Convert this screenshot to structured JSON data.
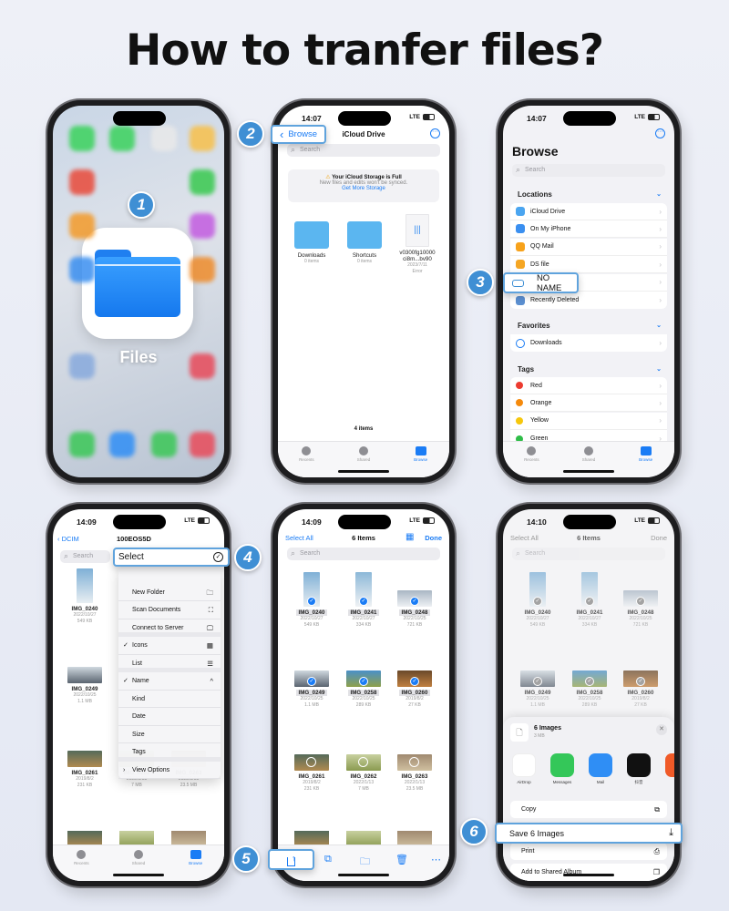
{
  "title": "How to tranfer files?",
  "colors": {
    "accent": "#1a7cf5",
    "badge": "#3f8fd4",
    "callout_border": "#5fa3dd"
  },
  "steps": [
    "1",
    "2",
    "3",
    "4",
    "5",
    "6"
  ],
  "phone1": {
    "app_label": "Files",
    "icon": "files-folder-icon"
  },
  "phone2": {
    "time": "14:07",
    "network": "LTE",
    "back_label": "Browse",
    "title": "iCloud Drive",
    "search_placeholder": "Search",
    "storage": {
      "title": "Your iCloud Storage is Full",
      "subtitle": "New files and edits won't be synced.",
      "link": "Get More Storage"
    },
    "items": [
      {
        "name": "Downloads",
        "meta": "0 items"
      },
      {
        "name": "Shortcuts",
        "meta": "0 items"
      },
      {
        "name": "v0300fg10000 ci8m...bv90",
        "meta": "2023/7/11",
        "meta2": "Error"
      }
    ],
    "count": "4 items",
    "tabs": [
      "Recents",
      "Shared",
      "Browse"
    ]
  },
  "phone3": {
    "time": "14:07",
    "network": "LTE",
    "title": "Browse",
    "search_placeholder": "Search",
    "locations_label": "Locations",
    "locations": [
      {
        "label": "iCloud Drive",
        "color": "#4aa5f0"
      },
      {
        "label": "On My iPhone",
        "color": "#3a8ff0"
      },
      {
        "label": "QQ Mail",
        "color": "#f7a21b"
      },
      {
        "label": "DS file",
        "color": "#f5a623"
      },
      {
        "label": "NO NAME",
        "color": "#8e8e93"
      },
      {
        "label": "Recently Deleted",
        "color": "#5b8fd0"
      }
    ],
    "favorites_label": "Favorites",
    "favorites": [
      {
        "label": "Downloads"
      }
    ],
    "tags_label": "Tags",
    "tags": [
      {
        "label": "Red",
        "color": "#ec3b30"
      },
      {
        "label": "Orange",
        "color": "#f58a0c"
      },
      {
        "label": "Yellow",
        "color": "#f6c70c"
      },
      {
        "label": "Green",
        "color": "#2fbd48"
      }
    ],
    "tabs": [
      "Recents",
      "Shared",
      "Browse"
    ]
  },
  "phone4": {
    "time": "14:09",
    "network": "LTE",
    "back_label": "DCIM",
    "title": "100EOS5D",
    "search_placeholder": "Search",
    "menu": [
      {
        "label": "Select",
        "icon": "checkmark-circle-icon",
        "glyph": "✓"
      },
      {
        "label": "New Folder",
        "icon": "new-folder-icon",
        "glyph": "🗀"
      },
      {
        "label": "Scan Documents",
        "icon": "scan-icon",
        "glyph": "⛶"
      },
      {
        "label": "Connect to Server",
        "icon": "monitor-icon",
        "glyph": "🖵"
      },
      {
        "label": "Icons",
        "checked": true,
        "icon": "grid-icon",
        "glyph": "▦"
      },
      {
        "label": "List",
        "icon": "list-icon",
        "glyph": "☰"
      },
      {
        "label": "Name",
        "checked": true,
        "icon": "chevron-up-icon",
        "glyph": "^"
      },
      {
        "label": "Kind"
      },
      {
        "label": "Date"
      },
      {
        "label": "Size"
      },
      {
        "label": "Tags"
      },
      {
        "label": "View Options",
        "prefix": ">"
      }
    ],
    "files": [
      {
        "name": "IMG_0240",
        "date": "2022/10/27",
        "size": "549 KB"
      },
      {
        "name": "IMG_0249",
        "date": "2022/10/25",
        "size": "1.1 MB"
      },
      {
        "name": "IMG_0261",
        "date": "2019/8/2",
        "size": "231 KB"
      },
      {
        "name": "IMG_0262",
        "date": "2022/1/13",
        "size": "7 MB"
      },
      {
        "name": "IMG_0263",
        "date": "2022/1/13",
        "size": "23.5 MB"
      }
    ],
    "tabs": [
      "Recents",
      "Shared",
      "Browse"
    ]
  },
  "phone5": {
    "time": "14:09",
    "network": "LTE",
    "select_all": "Select All",
    "title": "6 Items",
    "done": "Done",
    "search_placeholder": "Search",
    "files": [
      {
        "name": "IMG_0240",
        "date": "2022/10/27",
        "size": "549 KB",
        "selected": true
      },
      {
        "name": "IMG_0241",
        "date": "2022/10/27",
        "size": "334 KB",
        "selected": true
      },
      {
        "name": "IMG_0248",
        "date": "2022/10/25",
        "size": "721 KB",
        "selected": true
      },
      {
        "name": "IMG_0249",
        "date": "2022/10/25",
        "size": "1.1 MB",
        "selected": true
      },
      {
        "name": "IMG_0258",
        "date": "2022/10/25",
        "size": "289 KB",
        "selected": true
      },
      {
        "name": "IMG_0260",
        "date": "2019/8/2",
        "size": "27 KB",
        "selected": true
      },
      {
        "name": "IMG_0261",
        "date": "2019/8/2",
        "size": "231 KB",
        "selected": false
      },
      {
        "name": "IMG_0262",
        "date": "2022/1/13",
        "size": "7 MB",
        "selected": false
      },
      {
        "name": "IMG_0263",
        "date": "2022/1/13",
        "size": "23.5 MB",
        "selected": false
      }
    ],
    "toolbar": [
      "share-icon",
      "duplicate-icon",
      "folder-icon",
      "trash-icon",
      "more-icon"
    ]
  },
  "phone6": {
    "time": "14:10",
    "network": "LTE",
    "select_all": "Select All",
    "title": "6 Items",
    "done": "Done",
    "search_placeholder": "Search",
    "files": [
      {
        "name": "IMG_0240",
        "date": "2022/10/27",
        "size": "549 KB"
      },
      {
        "name": "IMG_0241",
        "date": "2022/10/27",
        "size": "334 KB"
      },
      {
        "name": "IMG_0248",
        "date": "2022/10/25",
        "size": "721 KB"
      },
      {
        "name": "IMG_0249",
        "date": "2022/10/25",
        "size": "1.1 MB"
      },
      {
        "name": "IMG_0258",
        "date": "2022/10/25",
        "size": "289 KB"
      },
      {
        "name": "IMG_0260",
        "date": "2019/8/2",
        "size": "27 KB"
      }
    ],
    "sheet": {
      "title": "6 Images",
      "size": "3 MB",
      "apps": [
        {
          "label": "AirDrop",
          "color": "#ffffff"
        },
        {
          "label": "Messages",
          "color": "#34c759"
        },
        {
          "label": "Mail",
          "color": "#2f8ef5"
        },
        {
          "label": "抖音",
          "color": "#111111"
        }
      ],
      "actions": [
        {
          "label": "Copy",
          "glyph": "⧉"
        },
        {
          "label": "Save 6 Images",
          "glyph": "⤓"
        },
        {
          "label": "Print",
          "glyph": "⎙"
        },
        {
          "label": "Add to Shared Album",
          "glyph": "❐"
        }
      ]
    }
  }
}
